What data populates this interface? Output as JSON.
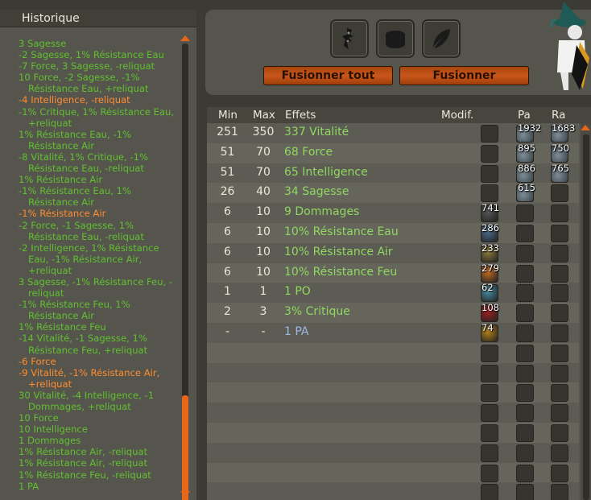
{
  "history": {
    "title": "Historique",
    "items": [
      {
        "color": "#60c030",
        "lines": [
          "3 Sagesse"
        ]
      },
      {
        "color": "#60c030",
        "lines": [
          "-2 Sagesse, 1% Résistance Eau"
        ]
      },
      {
        "color": "#60c030",
        "lines": [
          "-7 Force, 3 Sagesse, -reliquat"
        ]
      },
      {
        "color": "#60c030",
        "lines": [
          "10 Force, -2 Sagesse, -1%",
          "Résistance Eau, +reliquat"
        ]
      },
      {
        "color": "#ff8c30",
        "lines": [
          "-4 Intelligence, -reliquat"
        ]
      },
      {
        "color": "#60c030",
        "lines": [
          "-1% Critique, 1% Résistance Eau,",
          "+reliquat"
        ]
      },
      {
        "color": "#60c030",
        "lines": [
          "1% Résistance Eau, -1%",
          "Résistance Air"
        ]
      },
      {
        "color": "#60c030",
        "lines": [
          "-8 Vitalité, 1% Critique, -1%",
          "Résistance Eau, -reliquat"
        ]
      },
      {
        "color": "#60c030",
        "lines": [
          "1% Résistance Air"
        ]
      },
      {
        "color": "#60c030",
        "lines": [
          "-1% Résistance Eau, 1%",
          "Résistance Air"
        ]
      },
      {
        "color": "#ff8c30",
        "lines": [
          "-1% Résistance Air"
        ]
      },
      {
        "color": "#60c030",
        "lines": [
          "-2 Force, -1 Sagesse, 1%",
          "Résistance Eau, -reliquat"
        ]
      },
      {
        "color": "#60c030",
        "lines": [
          "-2 Intelligence, 1% Résistance",
          "Eau, -1% Résistance Air,",
          "+reliquat"
        ]
      },
      {
        "color": "#60c030",
        "lines": [
          "3 Sagesse, -1% Résistance Feu, -",
          "reliquat"
        ]
      },
      {
        "color": "#60c030",
        "lines": [
          "-1% Résistance Feu, 1%",
          "Résistance Air"
        ]
      },
      {
        "color": "#60c030",
        "lines": [
          "1% Résistance Feu"
        ]
      },
      {
        "color": "#60c030",
        "lines": [
          "-14 Vitalité, -1 Sagesse, 1%",
          "Résistance Feu, +reliquat"
        ]
      },
      {
        "color": "#ff8c30",
        "lines": [
          "-6 Force"
        ]
      },
      {
        "color": "#ff8c30",
        "lines": [
          "-9 Vitalité, -1% Résistance Air,",
          "+reliquat"
        ]
      },
      {
        "color": "#60c030",
        "lines": [
          "30 Vitalité, -4 Intelligence, -1",
          "Dommages, +reliquat"
        ]
      },
      {
        "color": "#60c030",
        "lines": [
          "10 Force"
        ]
      },
      {
        "color": "#60c030",
        "lines": [
          "10 Intelligence"
        ]
      },
      {
        "color": "#60c030",
        "lines": [
          "1 Dommages"
        ]
      },
      {
        "color": "#60c030",
        "lines": [
          "1% Résistance Air, -reliquat"
        ]
      },
      {
        "color": "#60c030",
        "lines": [
          "1% Résistance Air, -reliquat"
        ]
      },
      {
        "color": "#60c030",
        "lines": [
          "1% Résistance Feu, -reliquat"
        ]
      },
      {
        "color": "#60c030",
        "lines": [
          "1 PA"
        ]
      }
    ]
  },
  "toolbar": {
    "slots": [
      "item-icon",
      "runes-bag-icon",
      "feather-icon"
    ],
    "fusion_all_label": "Fusionner tout",
    "fusion_label": "Fusionner"
  },
  "table": {
    "headers": {
      "min": "Min",
      "max": "Max",
      "effects": "Effets",
      "modif": "Modif.",
      "pa": "Pa",
      "ra": "Ra"
    },
    "rows": [
      {
        "min": "251",
        "max": "350",
        "effect": "337 Vitalité",
        "effect_color": "#8fd860",
        "modif_rune": "",
        "modif_count": "",
        "pa": "1932",
        "ra": "1683",
        "rune_color": "#6f7f8a"
      },
      {
        "min": "51",
        "max": "70",
        "effect": "68 Force",
        "effect_color": "#8fd860",
        "modif_rune": "",
        "modif_count": "",
        "pa": "895",
        "ra": "750",
        "rune_color": "#6f7f8a"
      },
      {
        "min": "51",
        "max": "70",
        "effect": "65 Intelligence",
        "effect_color": "#8fd860",
        "modif_rune": "",
        "modif_count": "",
        "pa": "886",
        "ra": "765",
        "rune_color": "#6f7f8a"
      },
      {
        "min": "26",
        "max": "40",
        "effect": "34 Sagesse",
        "effect_color": "#8fd860",
        "modif_rune": "",
        "modif_count": "",
        "pa": "615",
        "ra": "",
        "rune_color": "#6f7f8a"
      },
      {
        "min": "6",
        "max": "10",
        "effect": "9 Dommages",
        "effect_color": "#8fd860",
        "modif_rune": "#555555",
        "modif_count": "741",
        "pa": "",
        "ra": ""
      },
      {
        "min": "6",
        "max": "10",
        "effect": "10% Résistance Eau",
        "effect_color": "#8fd860",
        "modif_rune": "#4a6a8a",
        "modif_count": "286",
        "pa": "",
        "ra": ""
      },
      {
        "min": "6",
        "max": "10",
        "effect": "10% Résistance Air",
        "effect_color": "#8fd860",
        "modif_rune": "#8a7a3a",
        "modif_count": "233",
        "pa": "",
        "ra": ""
      },
      {
        "min": "6",
        "max": "10",
        "effect": "10% Résistance Feu",
        "effect_color": "#8fd860",
        "modif_rune": "#c06a20",
        "modif_count": "279",
        "pa": "",
        "ra": ""
      },
      {
        "min": "1",
        "max": "1",
        "effect": "1 PO",
        "effect_color": "#8fd860",
        "modif_rune": "#4a8aa0",
        "modif_count": "62",
        "pa": "",
        "ra": ""
      },
      {
        "min": "2",
        "max": "3",
        "effect": "3% Critique",
        "effect_color": "#8fd860",
        "modif_rune": "#a02020",
        "modif_count": "108",
        "pa": "",
        "ra": ""
      },
      {
        "min": "-",
        "max": "-",
        "effect": "1 PA",
        "effect_color": "#9fb8e8",
        "modif_rune": "#b0801a",
        "modif_count": "74",
        "pa": "",
        "ra": ""
      },
      {
        "min": "",
        "max": "",
        "effect": "",
        "effect_color": "#8fd860",
        "modif_rune": "",
        "modif_count": "",
        "pa": "",
        "ra": ""
      },
      {
        "min": "",
        "max": "",
        "effect": "",
        "effect_color": "#8fd860",
        "modif_rune": "",
        "modif_count": "",
        "pa": "",
        "ra": ""
      },
      {
        "min": "",
        "max": "",
        "effect": "",
        "effect_color": "#8fd860",
        "modif_rune": "",
        "modif_count": "",
        "pa": "",
        "ra": ""
      },
      {
        "min": "",
        "max": "",
        "effect": "",
        "effect_color": "#8fd860",
        "modif_rune": "",
        "modif_count": "",
        "pa": "",
        "ra": ""
      },
      {
        "min": "",
        "max": "",
        "effect": "",
        "effect_color": "#8fd860",
        "modif_rune": "",
        "modif_count": "",
        "pa": "",
        "ra": ""
      },
      {
        "min": "",
        "max": "",
        "effect": "",
        "effect_color": "#8fd860",
        "modif_rune": "",
        "modif_count": "",
        "pa": "",
        "ra": ""
      },
      {
        "min": "",
        "max": "",
        "effect": "",
        "effect_color": "#8fd860",
        "modif_rune": "",
        "modif_count": "",
        "pa": "",
        "ra": ""
      },
      {
        "min": "",
        "max": "",
        "effect": "",
        "effect_color": "#8fd860",
        "modif_rune": "",
        "modif_count": "",
        "pa": "",
        "ra": ""
      },
      {
        "min": "",
        "max": "",
        "effect": "",
        "effect_color": "#8fd860",
        "modif_rune": "",
        "modif_count": "",
        "pa": "",
        "ra": ""
      }
    ]
  }
}
